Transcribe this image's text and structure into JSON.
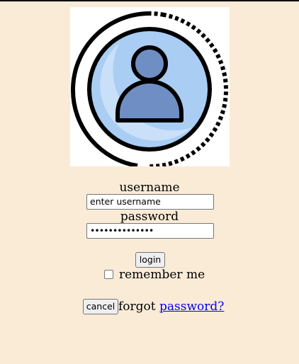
{
  "avatar": {
    "icon": "user-avatar-icon"
  },
  "form": {
    "username_label": "username",
    "username_value": "enter username",
    "password_label": "password",
    "password_value": "••••••••••••••",
    "login_label": "login",
    "remember_label": "remember me",
    "cancel_label": "cancel",
    "forgot_text": "forgot",
    "forgot_link": "password?"
  },
  "colors": {
    "background": "#faebd7",
    "link": "#0000ee"
  }
}
